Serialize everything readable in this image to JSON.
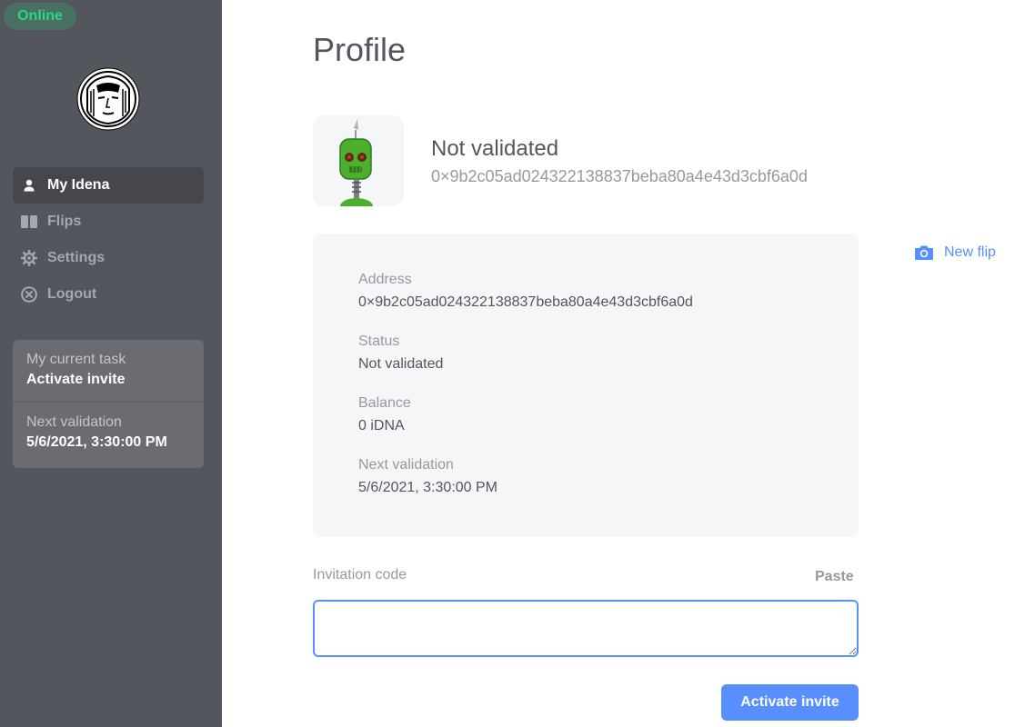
{
  "sidebar": {
    "connection_status": "Online",
    "logo_icon": "idena-logo-icon",
    "nav_items": [
      {
        "label": "My Idena",
        "icon": "user-icon",
        "active": true
      },
      {
        "label": "Flips",
        "icon": "flips-icon",
        "active": false
      },
      {
        "label": "Settings",
        "icon": "gear-icon",
        "active": false
      },
      {
        "label": "Logout",
        "icon": "close-circle-icon",
        "active": false
      }
    ],
    "task_card": {
      "task_label": "My current task",
      "task_value": "Activate invite",
      "validation_label": "Next validation",
      "validation_value": "5/6/2021, 3:30:00 PM"
    }
  },
  "main": {
    "title": "Profile",
    "profile": {
      "state": "Not validated",
      "address": "0×9b2c05ad024322138837beba80a4e43d3cbf6a0d"
    },
    "new_flip_label": "New flip",
    "details": [
      {
        "label": "Address",
        "value": "0×9b2c05ad024322138837beba80a4e43d3cbf6a0d"
      },
      {
        "label": "Status",
        "value": "Not validated"
      },
      {
        "label": "Balance",
        "value": "0 iDNA"
      },
      {
        "label": "Next validation",
        "value": "5/6/2021, 3:30:00 PM"
      }
    ],
    "invite": {
      "label": "Invitation code",
      "paste_label": "Paste",
      "value": "",
      "button_label": "Activate invite"
    }
  },
  "colors": {
    "sidebar_bg": "#53565c",
    "accent": "#578fff",
    "online": "#27d980",
    "card_bg": "#f5f6f7",
    "muted_text": "#96999e"
  }
}
